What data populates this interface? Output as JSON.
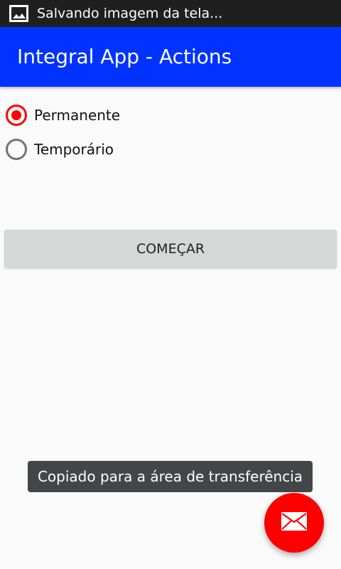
{
  "status_bar": {
    "notification_text": "Salvando imagem da tela...",
    "icon": "image-icon",
    "background": "#1f1f1f"
  },
  "app_bar": {
    "title": "Integral App - Actions",
    "background": "#0033ff"
  },
  "radio_group": {
    "options": [
      {
        "label": "Permanente",
        "checked": true
      },
      {
        "label": "Temporário",
        "checked": false
      }
    ],
    "accent_color": "#ff0000"
  },
  "start_button": {
    "label": "COMEÇAR"
  },
  "toast": {
    "message": "Copiado para a área de transferência"
  },
  "fab": {
    "icon": "email-icon",
    "color": "#ff0000"
  }
}
